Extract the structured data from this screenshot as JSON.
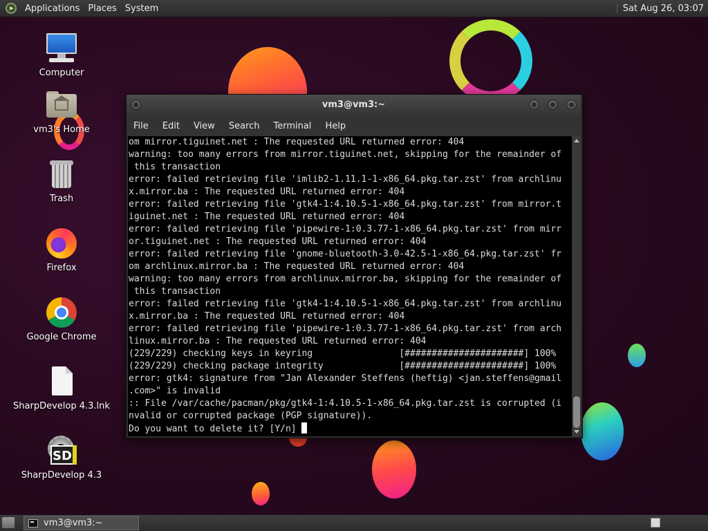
{
  "top_panel": {
    "menus": [
      "Applications",
      "Places",
      "System"
    ],
    "clock": "Sat Aug 26, 03:07"
  },
  "desktop_icons": [
    {
      "label": "Computer",
      "icon": "computer-icon"
    },
    {
      "label": "vm3's Home",
      "icon": "home-folder-icon"
    },
    {
      "label": "Trash",
      "icon": "trash-icon"
    },
    {
      "label": "Firefox",
      "icon": "firefox-icon"
    },
    {
      "label": "Google Chrome",
      "icon": "chrome-icon"
    },
    {
      "label": "SharpDevelop 4.3.lnk",
      "icon": "file-icon"
    },
    {
      "label": "SharpDevelop 4.3",
      "icon": "sharpdevelop-icon"
    }
  ],
  "terminal": {
    "title": "vm3@vm3:~",
    "menu": [
      "File",
      "Edit",
      "View",
      "Search",
      "Terminal",
      "Help"
    ],
    "lines": [
      "om mirror.tiguinet.net : The requested URL returned error: 404",
      "warning: too many errors from mirror.tiguinet.net, skipping for the remainder of",
      " this transaction",
      "error: failed retrieving file 'imlib2-1.11.1-1-x86_64.pkg.tar.zst' from archlinu",
      "x.mirror.ba : The requested URL returned error: 404",
      "error: failed retrieving file 'gtk4-1:4.10.5-1-x86_64.pkg.tar.zst' from mirror.t",
      "iguinet.net : The requested URL returned error: 404",
      "error: failed retrieving file 'pipewire-1:0.3.77-1-x86_64.pkg.tar.zst' from mirr",
      "or.tiguinet.net : The requested URL returned error: 404",
      "error: failed retrieving file 'gnome-bluetooth-3.0-42.5-1-x86_64.pkg.tar.zst' fr",
      "om archlinux.mirror.ba : The requested URL returned error: 404",
      "warning: too many errors from archlinux.mirror.ba, skipping for the remainder of",
      " this transaction",
      "error: failed retrieving file 'gtk4-1:4.10.5-1-x86_64.pkg.tar.zst' from archlinu",
      "x.mirror.ba : The requested URL returned error: 404",
      "error: failed retrieving file 'pipewire-1:0.3.77-1-x86_64.pkg.tar.zst' from arch",
      "linux.mirror.ba : The requested URL returned error: 404",
      "(229/229) checking keys in keyring                [######################] 100%",
      "(229/229) checking package integrity              [######################] 100%",
      "error: gtk4: signature from \"Jan Alexander Steffens (heftig) <jan.steffens@gmail",
      ".com>\" is invalid",
      ":: File /var/cache/pacman/pkg/gtk4-1:4.10.5-1-x86_64.pkg.tar.zst is corrupted (i",
      "nvalid or corrupted package (PGP signature)).",
      "Do you want to delete it? [Y/n] "
    ]
  },
  "taskbar": {
    "task_label": "vm3@vm3:~"
  }
}
